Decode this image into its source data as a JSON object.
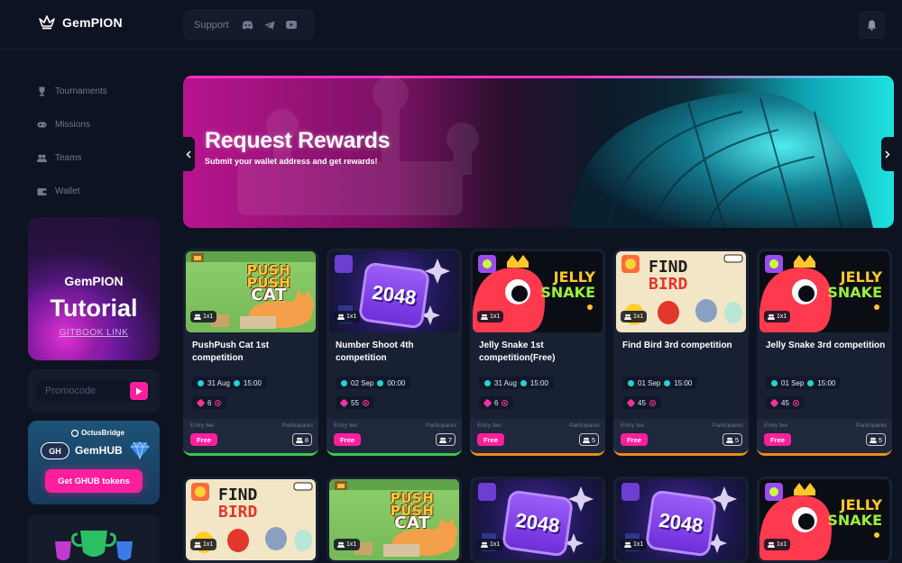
{
  "app": {
    "name": "GemPION"
  },
  "header": {
    "support_label": "Support",
    "social_icons": [
      "discord-icon",
      "telegram-icon",
      "youtube-icon"
    ],
    "notification_icon": "bell-icon"
  },
  "sidebar": {
    "items": [
      {
        "label": "Tournaments",
        "icon": "trophy-icon"
      },
      {
        "label": "Missions",
        "icon": "gamepad-icon"
      },
      {
        "label": "Teams",
        "icon": "users-icon"
      },
      {
        "label": "Wallet",
        "icon": "wallet-icon"
      }
    ],
    "tutorial": {
      "small": "GemPION",
      "big": "Tutorial",
      "link": "GITBOOK LINK"
    },
    "promo": {
      "placeholder": "Promocode"
    },
    "gemhub": {
      "brand": "OctusBridge",
      "badge": "GH",
      "title": "GemHUB",
      "button": "Get GHUB tokens"
    }
  },
  "banner": {
    "title": "Request Rewards",
    "subtitle": "Submit your wallet address and get rewards!"
  },
  "cards_labels": {
    "entry_fee": "Entry fee",
    "participants": "Participants",
    "mode": "1x1"
  },
  "cards": [
    {
      "title": "PushPush Cat 1st competition",
      "date": "31 Aug",
      "time": "15:00",
      "prize": "6",
      "fee": "Free",
      "participants": "8",
      "art": "cat",
      "border": "green"
    },
    {
      "title": "Number Shoot 4th competition",
      "date": "02 Sep",
      "time": "00:00",
      "prize": "55",
      "fee": "Free",
      "participants": "7",
      "art": "2048",
      "border": "green"
    },
    {
      "title": "Jelly Snake 1st competition(Free)",
      "date": "31 Aug",
      "time": "15:00",
      "prize": "6",
      "fee": "Free",
      "participants": "5",
      "art": "jelly",
      "border": "orange"
    },
    {
      "title": "Find Bird 3rd competition",
      "date": "01 Sep",
      "time": "15:00",
      "prize": "45",
      "fee": "Free",
      "participants": "5",
      "art": "bird",
      "border": "orange"
    },
    {
      "title": "Jelly Snake 3rd competition",
      "date": "01 Sep",
      "time": "15:00",
      "prize": "45",
      "fee": "Free",
      "participants": "5",
      "art": "jelly",
      "border": "orange"
    }
  ],
  "second_row_art": [
    "bird",
    "cat",
    "2048",
    "2048",
    "jelly"
  ],
  "game_art": {
    "cat": {
      "line1": "PUSH",
      "line2": "PUSH",
      "line3": "CAT"
    },
    "num": {
      "text": "2048"
    },
    "jelly": {
      "line1": "JELLY",
      "line2": "SNAKE"
    },
    "bird": {
      "line1": "FIND",
      "line2": "BIRD"
    }
  },
  "colors": {
    "accent": "#ff1f9e",
    "cyan": "#22d3d8",
    "background": "#0d1321",
    "card": "#182033"
  }
}
